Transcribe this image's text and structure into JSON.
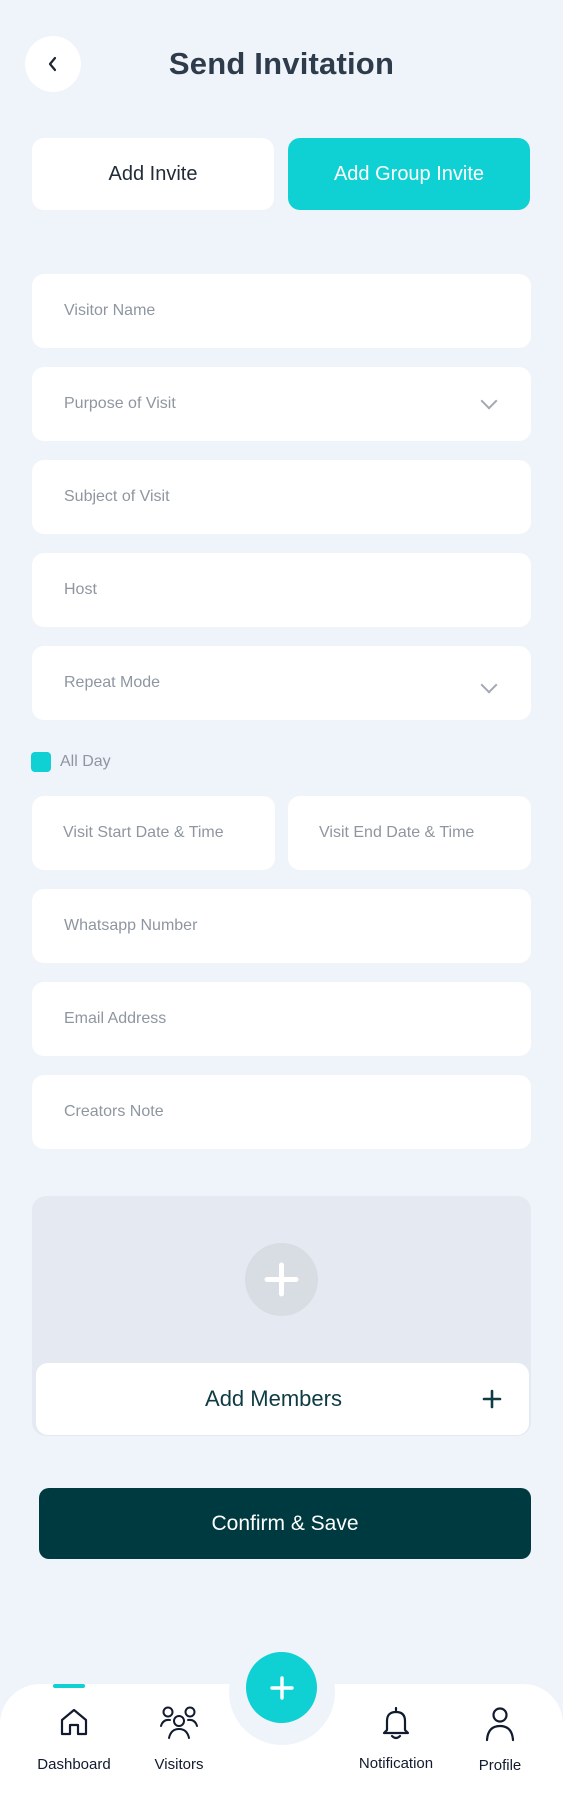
{
  "header": {
    "title": "Send Invitation",
    "back_icon": "chevron-left-icon"
  },
  "tabs": [
    {
      "label": "Add Invite",
      "active": false
    },
    {
      "label": "Add Group Invite",
      "active": true
    }
  ],
  "form": {
    "visitor_name": {
      "placeholder": "Visitor Name",
      "value": ""
    },
    "purpose_of_visit": {
      "placeholder": "Purpose of Visit",
      "value": ""
    },
    "subject_of_visit": {
      "placeholder": "Subject of Visit",
      "value": ""
    },
    "host": {
      "placeholder": "Host",
      "value": ""
    },
    "repeat_mode": {
      "placeholder": "Repeat Mode",
      "value": ""
    },
    "all_day": {
      "label": "All Day",
      "checked": true
    },
    "visit_start": {
      "placeholder": "Visit Start Date & Time",
      "value": ""
    },
    "visit_end": {
      "placeholder": "Visit End Date & Time",
      "value": ""
    },
    "whatsapp": {
      "placeholder": "Whatsapp Number",
      "value": ""
    },
    "email": {
      "placeholder": "Email Address",
      "value": ""
    },
    "creators_note": {
      "placeholder": "Creators Note",
      "value": ""
    }
  },
  "members": {
    "add_label": "Add Members"
  },
  "confirm_label": "Confirm & Save",
  "bottom_nav": {
    "items": [
      {
        "label": "Dashboard",
        "icon": "home-icon",
        "active": true
      },
      {
        "label": "Visitors",
        "icon": "users-icon",
        "active": false
      },
      {
        "label": "Notification",
        "icon": "bell-icon",
        "active": false
      },
      {
        "label": "Profile",
        "icon": "user-icon",
        "active": false
      }
    ],
    "fab_icon": "plus-icon"
  },
  "colors": {
    "accent": "#0fd0d3",
    "dark": "#003a41",
    "background": "#eff3fa"
  }
}
